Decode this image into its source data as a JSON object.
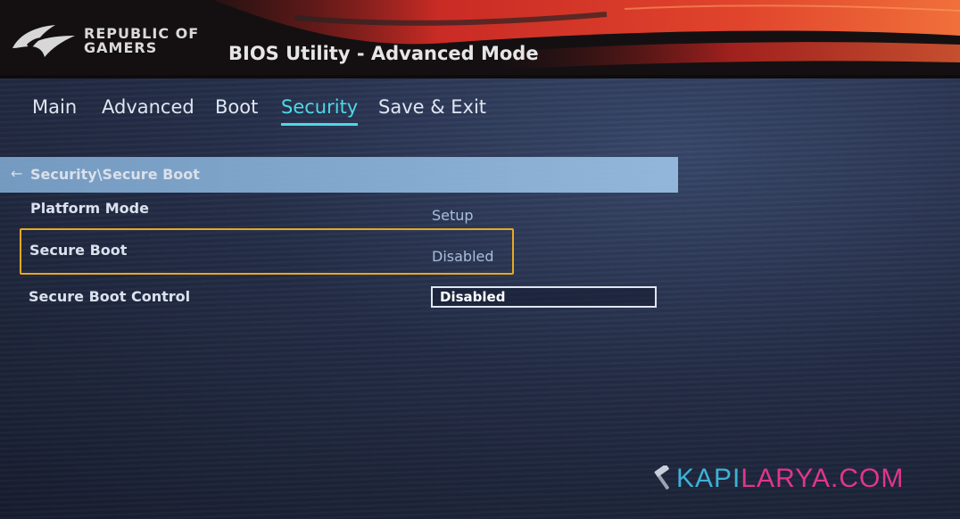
{
  "header": {
    "brand_line1": "REPUBLIC OF",
    "brand_line2": "GAMERS",
    "title": "BIOS Utility - Advanced Mode"
  },
  "tabs": [
    {
      "label": "Main",
      "active": false
    },
    {
      "label": "Advanced",
      "active": false
    },
    {
      "label": "Boot",
      "active": false
    },
    {
      "label": "Security",
      "active": true
    },
    {
      "label": "Save & Exit",
      "active": false
    }
  ],
  "breadcrumb": {
    "icon": "back-arrow-icon",
    "text": "Security\\Secure Boot"
  },
  "settings": [
    {
      "label": "Platform Mode",
      "value": "Setup"
    },
    {
      "label": "Secure Boot",
      "value": "Disabled",
      "highlighted": true
    },
    {
      "label": "Secure Boot Control",
      "value": "Disabled",
      "editable": true
    }
  ],
  "watermark": {
    "icon": "hammer-icon",
    "part1": "KAPI",
    "part2": "LARYA.COM"
  },
  "colors": {
    "accent": "#4ed8e6",
    "highlight": "#e7a91f",
    "header_red": "#d8322c",
    "watermark_blue": "#3db2d8",
    "watermark_pink": "#e0368c"
  }
}
